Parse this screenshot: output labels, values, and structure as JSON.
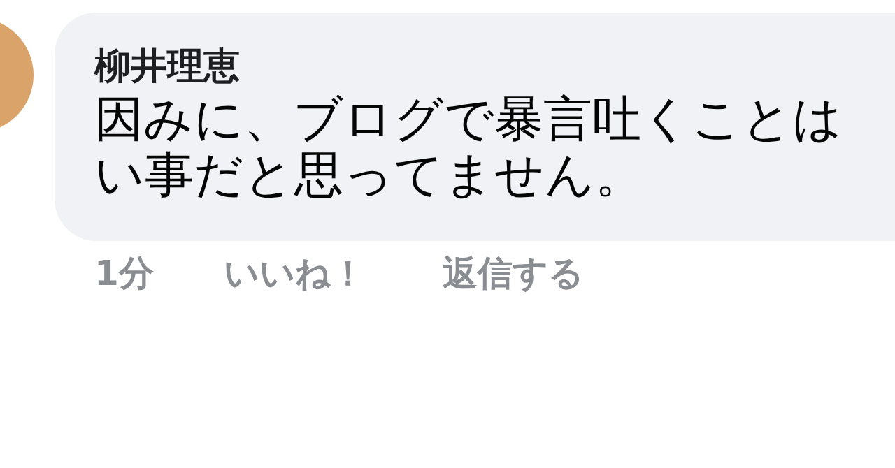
{
  "comment": {
    "author": "柳井理恵",
    "body_lines": [
      "因みに、ブログで暴言吐くことは",
      "い事だと思ってません。"
    ],
    "actions": [
      "1分",
      "いいね！",
      "返信する"
    ]
  }
}
